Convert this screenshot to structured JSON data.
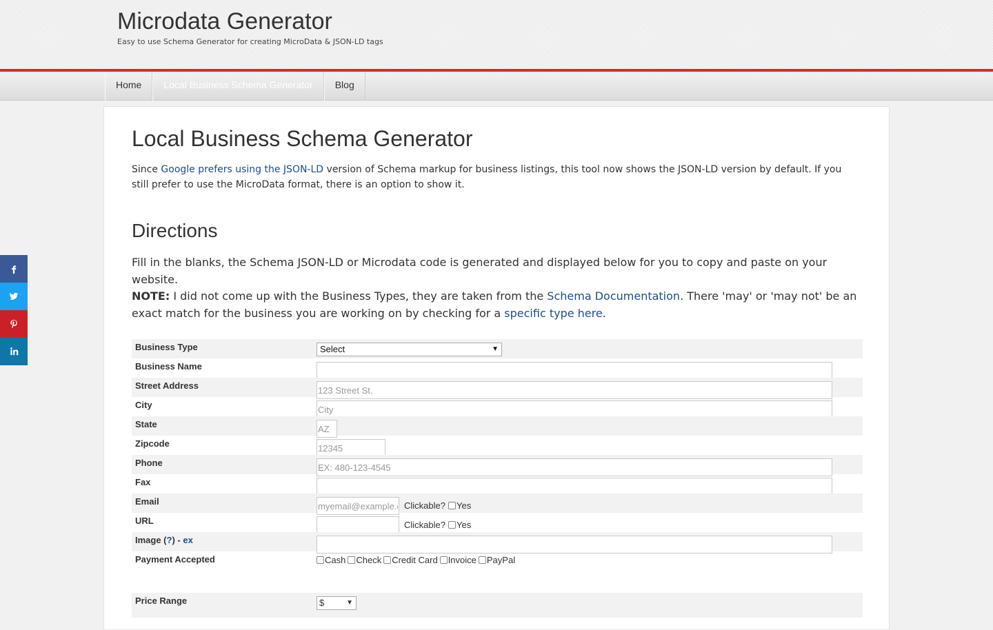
{
  "header": {
    "title": "Microdata Generator",
    "tagline": "Easy to use Schema Generator for creating MicroData & JSON-LD tags"
  },
  "nav": {
    "items": [
      {
        "label": "Home"
      },
      {
        "label": "Local Business Schema Generator",
        "active": true
      },
      {
        "label": "Blog"
      }
    ]
  },
  "social": {
    "icons": [
      "facebook-icon",
      "twitter-icon",
      "pinterest-icon",
      "linkedin-icon"
    ],
    "colors": {
      "facebook": "#3b5998",
      "twitter": "#1da1f2",
      "pinterest": "#cb2027",
      "linkedin": "#0e76a8"
    }
  },
  "page": {
    "title": "Local Business Schema Generator",
    "intro_pre": "Since ",
    "intro_link": "Google prefers using the JSON-LD",
    "intro_post": " version of Schema markup for business listings, this tool now shows the JSON-LD version by default. If you still prefer to use the MicroData format, there is an option to show it.",
    "directions_title": "Directions",
    "directions_text": "Fill in the blanks, the Schema JSON-LD or Microdata code is generated and displayed below for you to copy and paste on your website.",
    "note_label": "NOTE:",
    "note_pre": " I did not come up with the Business Types, they are taken from the ",
    "note_link1": "Schema Documentation",
    "note_mid": ". There 'may' or 'may not' be an exact match for the business you are working on by checking for a ",
    "note_link2": "specific type here",
    "note_post": "."
  },
  "form": {
    "business_type": {
      "label": "Business Type",
      "value": "Select"
    },
    "business_name": {
      "label": "Business Name",
      "placeholder": ""
    },
    "street": {
      "label": "Street Address",
      "placeholder": "123 Street St."
    },
    "city": {
      "label": "City",
      "placeholder": "City"
    },
    "state": {
      "label": "State",
      "placeholder": "AZ"
    },
    "zipcode": {
      "label": "Zipcode",
      "placeholder": "12345"
    },
    "phone": {
      "label": "Phone",
      "placeholder": "EX: 480-123-4545"
    },
    "fax": {
      "label": "Fax",
      "placeholder": ""
    },
    "email": {
      "label": "Email",
      "placeholder": "myemail@example.com",
      "clickable_label": "Clickable?",
      "yes_label": "Yes"
    },
    "url": {
      "label": "URL",
      "placeholder": "",
      "clickable_label": "Clickable?",
      "yes_label": "Yes"
    },
    "image": {
      "label_pre": "Image (",
      "help_link": "?",
      "label_mid": ") - ",
      "ex_link": "ex",
      "placeholder": ""
    },
    "payment": {
      "label": "Payment Accepted",
      "options": [
        "Cash",
        "Check",
        "Credit Card",
        "Invoice",
        "PayPal"
      ]
    },
    "price_range": {
      "label": "Price Range",
      "value": "$"
    }
  },
  "colors": {
    "accent_red": "#dd2929",
    "link": "#1e4c8f"
  }
}
